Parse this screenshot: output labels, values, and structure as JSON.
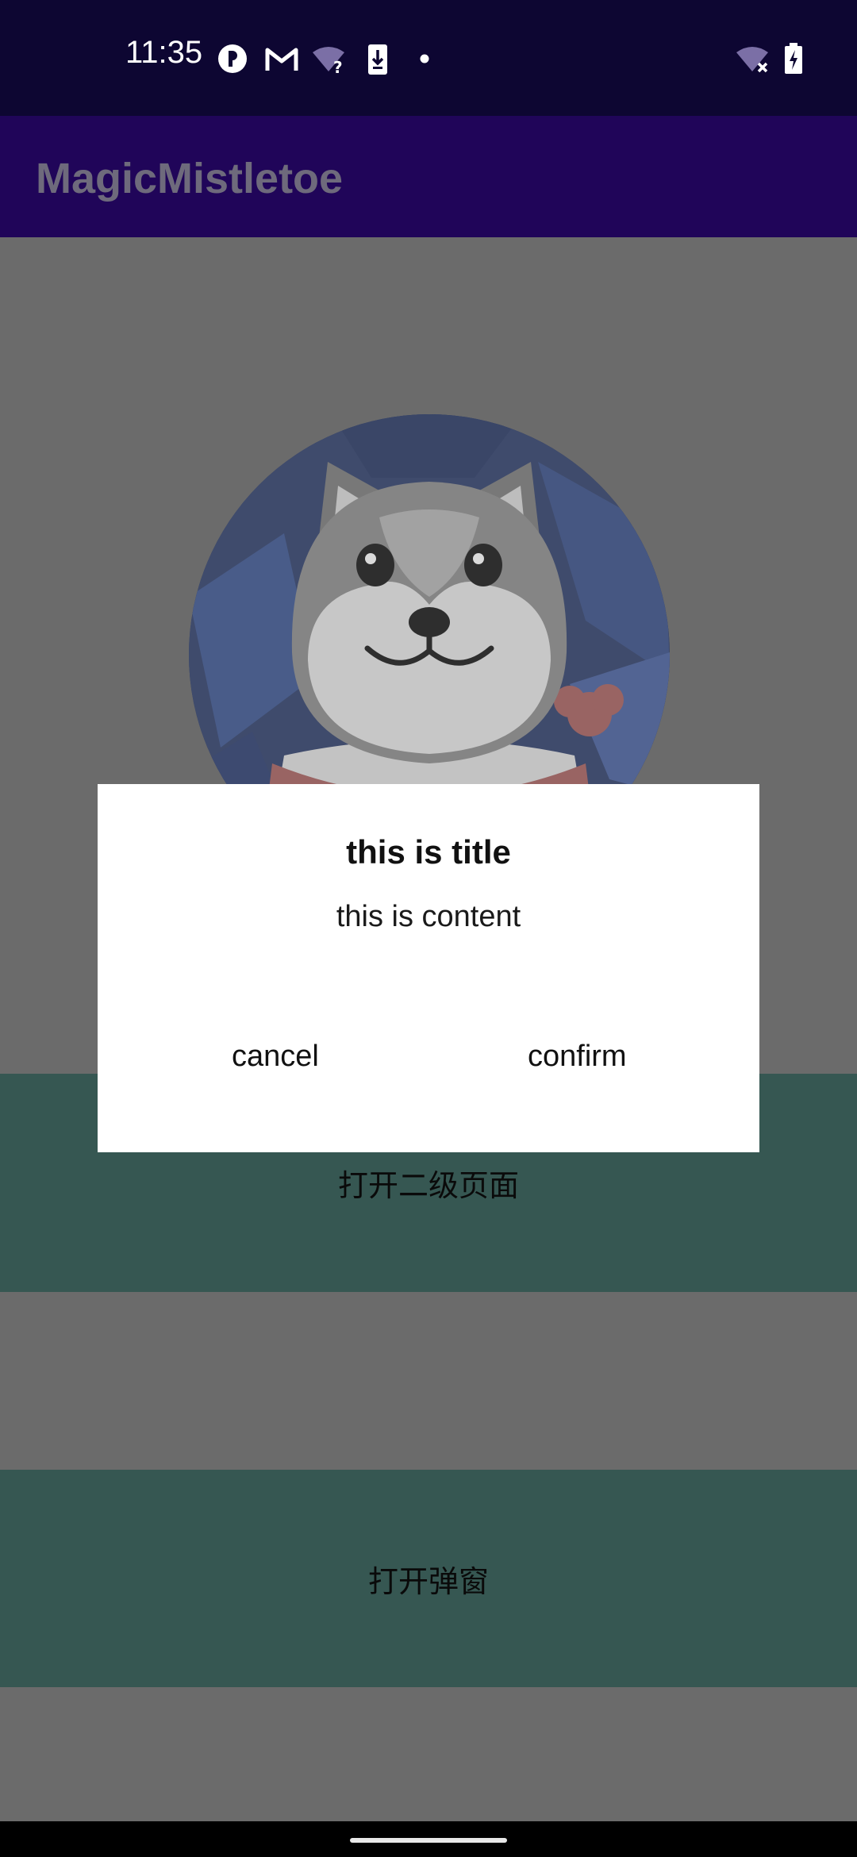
{
  "status_bar": {
    "time": "11:35",
    "icons": [
      "sync-icon",
      "gmail-icon",
      "wifi-unknown-icon",
      "download-icon",
      "dot-icon",
      "wifi-off-icon",
      "battery-charging-icon"
    ],
    "background": "#0d0632"
  },
  "app_bar": {
    "title": "MagicMistletoe",
    "background": "#200559"
  },
  "main": {
    "avatar_icon": "husky-dog-avatar",
    "secondary_page_button": "打开二级页面",
    "open_dialog_button": "打开弹窗",
    "button_color": "#365752"
  },
  "dialog": {
    "title": "this is title",
    "content": "this is content",
    "cancel_label": "cancel",
    "confirm_label": "confirm"
  },
  "nav_bar": {
    "handle_icon": "home-handle"
  }
}
